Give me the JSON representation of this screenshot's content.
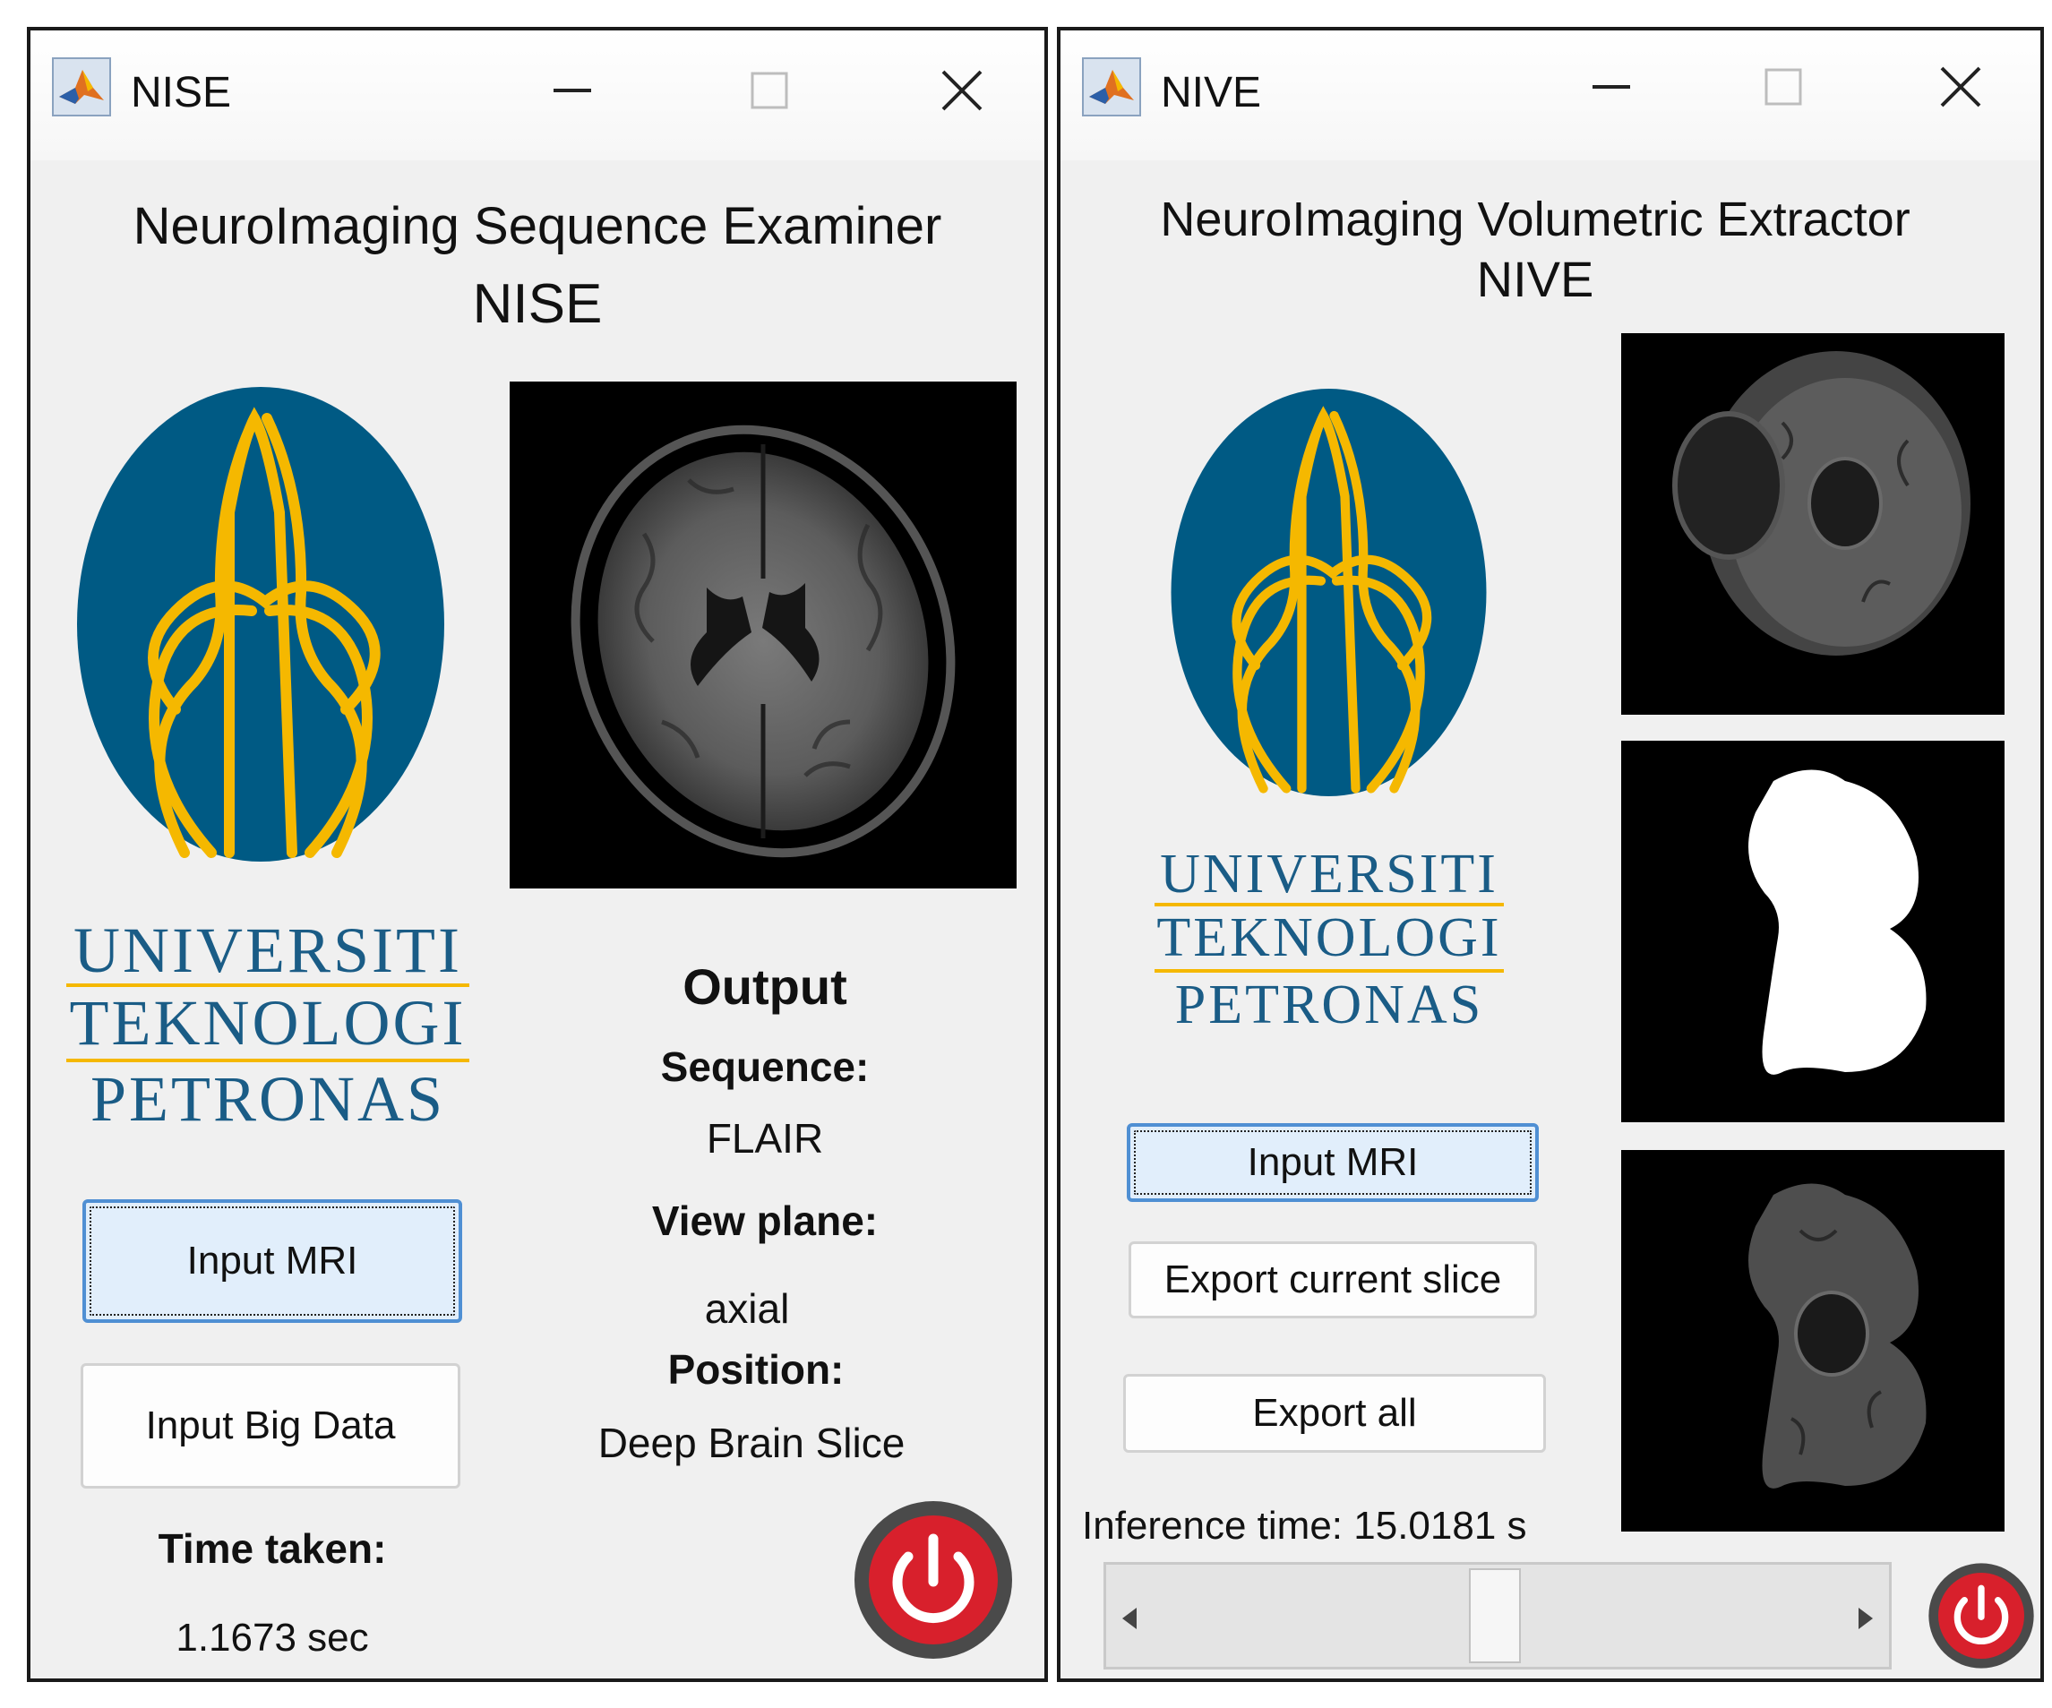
{
  "nise": {
    "window_title": "NISE",
    "heading_line1": "NeuroImaging Sequence Examiner",
    "heading_line2": "NISE",
    "logo_text": [
      "UNIVERSITI",
      "TEKNOLOGI",
      "PETRONAS"
    ],
    "input_mri_label": "Input MRI",
    "input_big_data_label": "Input Big Data",
    "time_taken_label": "Time taken:",
    "time_taken_value": "1.1673 sec",
    "output_label": "Output",
    "sequence_label": "Sequence:",
    "sequence_value": "FLAIR",
    "view_plane_label": "View plane:",
    "view_plane_value": "axial",
    "position_label": "Position:",
    "position_value": "Deep Brain Slice"
  },
  "nive": {
    "window_title": "NIVE",
    "heading_line1": "NeuroImaging Volumetric Extractor",
    "heading_line2": "NIVE",
    "logo_text": [
      "UNIVERSITI",
      "TEKNOLOGI",
      "PETRONAS"
    ],
    "input_mri_label": "Input MRI",
    "export_current_label": "Export current slice",
    "export_all_label": "Export all",
    "inference_time": "Inference time: 15.0181 s",
    "slider_value": 0.55
  },
  "colors": {
    "logo_blue": "#005a84",
    "logo_gold": "#f5b800",
    "power_red": "#d8202c"
  },
  "icons": [
    "matlab-icon",
    "minimize-icon",
    "maximize-icon",
    "close-icon",
    "power-icon",
    "arrow-left-icon",
    "arrow-right-icon"
  ]
}
